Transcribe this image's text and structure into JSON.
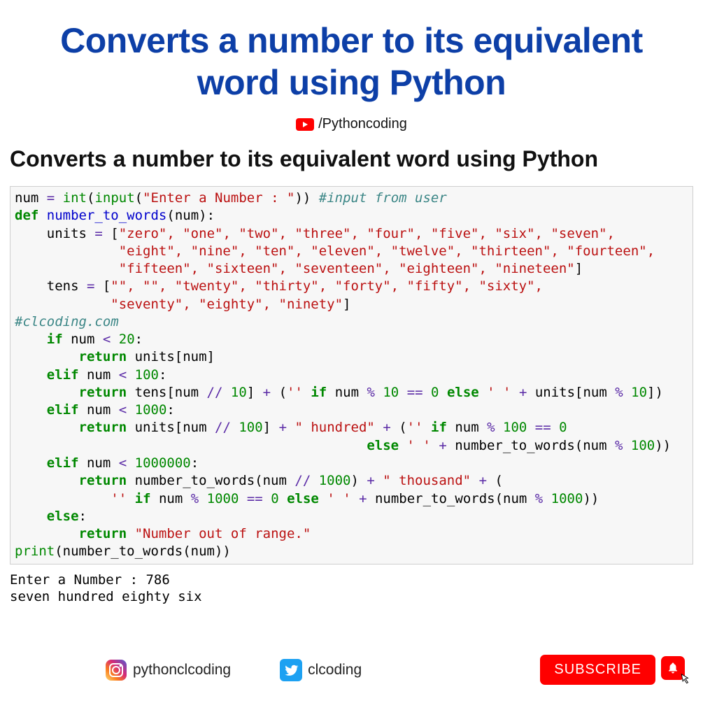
{
  "header": {
    "title_line1": "Converts a number to its equivalent",
    "title_line2": "word using Python",
    "youtube_handle": "/Pythoncoding"
  },
  "subtitle": "Converts a number to its equivalent word using Python",
  "code": {
    "l01_a": "num ",
    "l01_op": "= ",
    "l01_int": "int",
    "l01_p": "(",
    "l01_input": "input",
    "l01_p2": "(",
    "l01_s": "\"Enter a Number : \"",
    "l01_p3": ")) ",
    "l01_c": "#input from user",
    "l02_def": "def",
    "l02_sp": " ",
    "l02_fn": "number_to_words",
    "l02_rest": "(num):",
    "l03_a": "    units ",
    "l03_op": "= ",
    "l03_b": "[",
    "l03_s": "\"zero\", \"one\", \"two\", \"three\", \"four\", \"five\", \"six\", \"seven\",",
    "l04_pad": "             ",
    "l04_s": "\"eight\", \"nine\", \"ten\", \"eleven\", \"twelve\", \"thirteen\", \"fourteen\",",
    "l05_pad": "             ",
    "l05_s": "\"fifteen\", \"sixteen\", \"seventeen\", \"eighteen\", \"nineteen\"",
    "l05_b": "]",
    "l06_a": "    tens ",
    "l06_op": "= ",
    "l06_b": "[",
    "l06_s": "\"\", \"\", \"twenty\", \"thirty\", \"forty\", \"fifty\", \"sixty\",",
    "l07_pad": "            ",
    "l07_s": "\"seventy\", \"eighty\", \"ninety\"",
    "l07_b": "]",
    "l08_c": "#clcoding.com",
    "l09_pad": "    ",
    "l09_if": "if",
    "l09_rest": " num ",
    "l09_op": "<",
    "l09_sp": " ",
    "l09_n": "20",
    "l09_col": ":",
    "l10_pad": "        ",
    "l10_ret": "return",
    "l10_rest": " units[num]",
    "l11_pad": "    ",
    "l11_elif": "elif",
    "l11_rest": " num ",
    "l11_op": "<",
    "l11_sp": " ",
    "l11_n": "100",
    "l11_col": ":",
    "l12_pad": "        ",
    "l12_ret": "return",
    "l12_a": " tens[num ",
    "l12_op1": "//",
    "l12_b": " ",
    "l12_n1": "10",
    "l12_c": "] ",
    "l12_op2": "+",
    "l12_d": " (",
    "l12_s1": "''",
    "l12_e": " ",
    "l12_if": "if",
    "l12_f": " num ",
    "l12_op3": "%",
    "l12_g": " ",
    "l12_n2": "10",
    "l12_h": " ",
    "l12_op4": "==",
    "l12_i": " ",
    "l12_n3": "0",
    "l12_j": " ",
    "l12_else": "else",
    "l12_k": " ",
    "l12_s2": "' '",
    "l12_l": " ",
    "l12_op5": "+",
    "l12_m": " units[num ",
    "l12_op6": "%",
    "l12_nn": " ",
    "l12_n4": "10",
    "l12_o": "])",
    "l13_pad": "    ",
    "l13_elif": "elif",
    "l13_rest": " num ",
    "l13_op": "<",
    "l13_sp": " ",
    "l13_n": "1000",
    "l13_col": ":",
    "l14_pad": "        ",
    "l14_ret": "return",
    "l14_a": " units[num ",
    "l14_op1": "//",
    "l14_b": " ",
    "l14_n1": "100",
    "l14_c": "] ",
    "l14_op2": "+",
    "l14_d": " ",
    "l14_s1": "\" hundred\"",
    "l14_e": " ",
    "l14_op3": "+",
    "l14_f": " (",
    "l14_s2": "''",
    "l14_g": " ",
    "l14_if": "if",
    "l14_h": " num ",
    "l14_op4": "%",
    "l14_i": " ",
    "l14_n2": "100",
    "l14_j": " ",
    "l14_op5": "==",
    "l14_k": " ",
    "l14_n3": "0",
    "l15_pad": "                                            ",
    "l15_else": "else",
    "l15_a": " ",
    "l15_s1": "' '",
    "l15_b": " ",
    "l15_op1": "+",
    "l15_c": " number_to_words(num ",
    "l15_op2": "%",
    "l15_d": " ",
    "l15_n1": "100",
    "l15_e": "))",
    "l16_pad": "    ",
    "l16_elif": "elif",
    "l16_rest": " num ",
    "l16_op": "<",
    "l16_sp": " ",
    "l16_n": "1000000",
    "l16_col": ":",
    "l17_pad": "        ",
    "l17_ret": "return",
    "l17_a": " number_to_words(num ",
    "l17_op1": "//",
    "l17_b": " ",
    "l17_n1": "1000",
    "l17_c": ") ",
    "l17_op2": "+",
    "l17_d": " ",
    "l17_s1": "\" thousand\"",
    "l17_e": " ",
    "l17_op3": "+",
    "l17_f": " (",
    "l18_pad": "            ",
    "l18_s1": "''",
    "l18_a": " ",
    "l18_if": "if",
    "l18_b": " num ",
    "l18_op1": "%",
    "l18_c": " ",
    "l18_n1": "1000",
    "l18_d": " ",
    "l18_op2": "==",
    "l18_e": " ",
    "l18_n2": "0",
    "l18_f": " ",
    "l18_else": "else",
    "l18_g": " ",
    "l18_s2": "' '",
    "l18_h": " ",
    "l18_op3": "+",
    "l18_i": " number_to_words(num ",
    "l18_op4": "%",
    "l18_j": " ",
    "l18_n3": "1000",
    "l18_k": "))",
    "l19_pad": "    ",
    "l19_else": "else",
    "l19_col": ":",
    "l20_pad": "        ",
    "l20_ret": "return",
    "l20_sp": " ",
    "l20_s": "\"Number out of range.\"",
    "l21_print": "print",
    "l21_rest": "(number_to_words(num))"
  },
  "output": {
    "line1": "Enter a Number : 786",
    "line2": "seven hundred eighty six"
  },
  "footer": {
    "instagram": "pythonclcoding",
    "twitter": "clcoding",
    "subscribe": "SUBSCRIBE"
  }
}
